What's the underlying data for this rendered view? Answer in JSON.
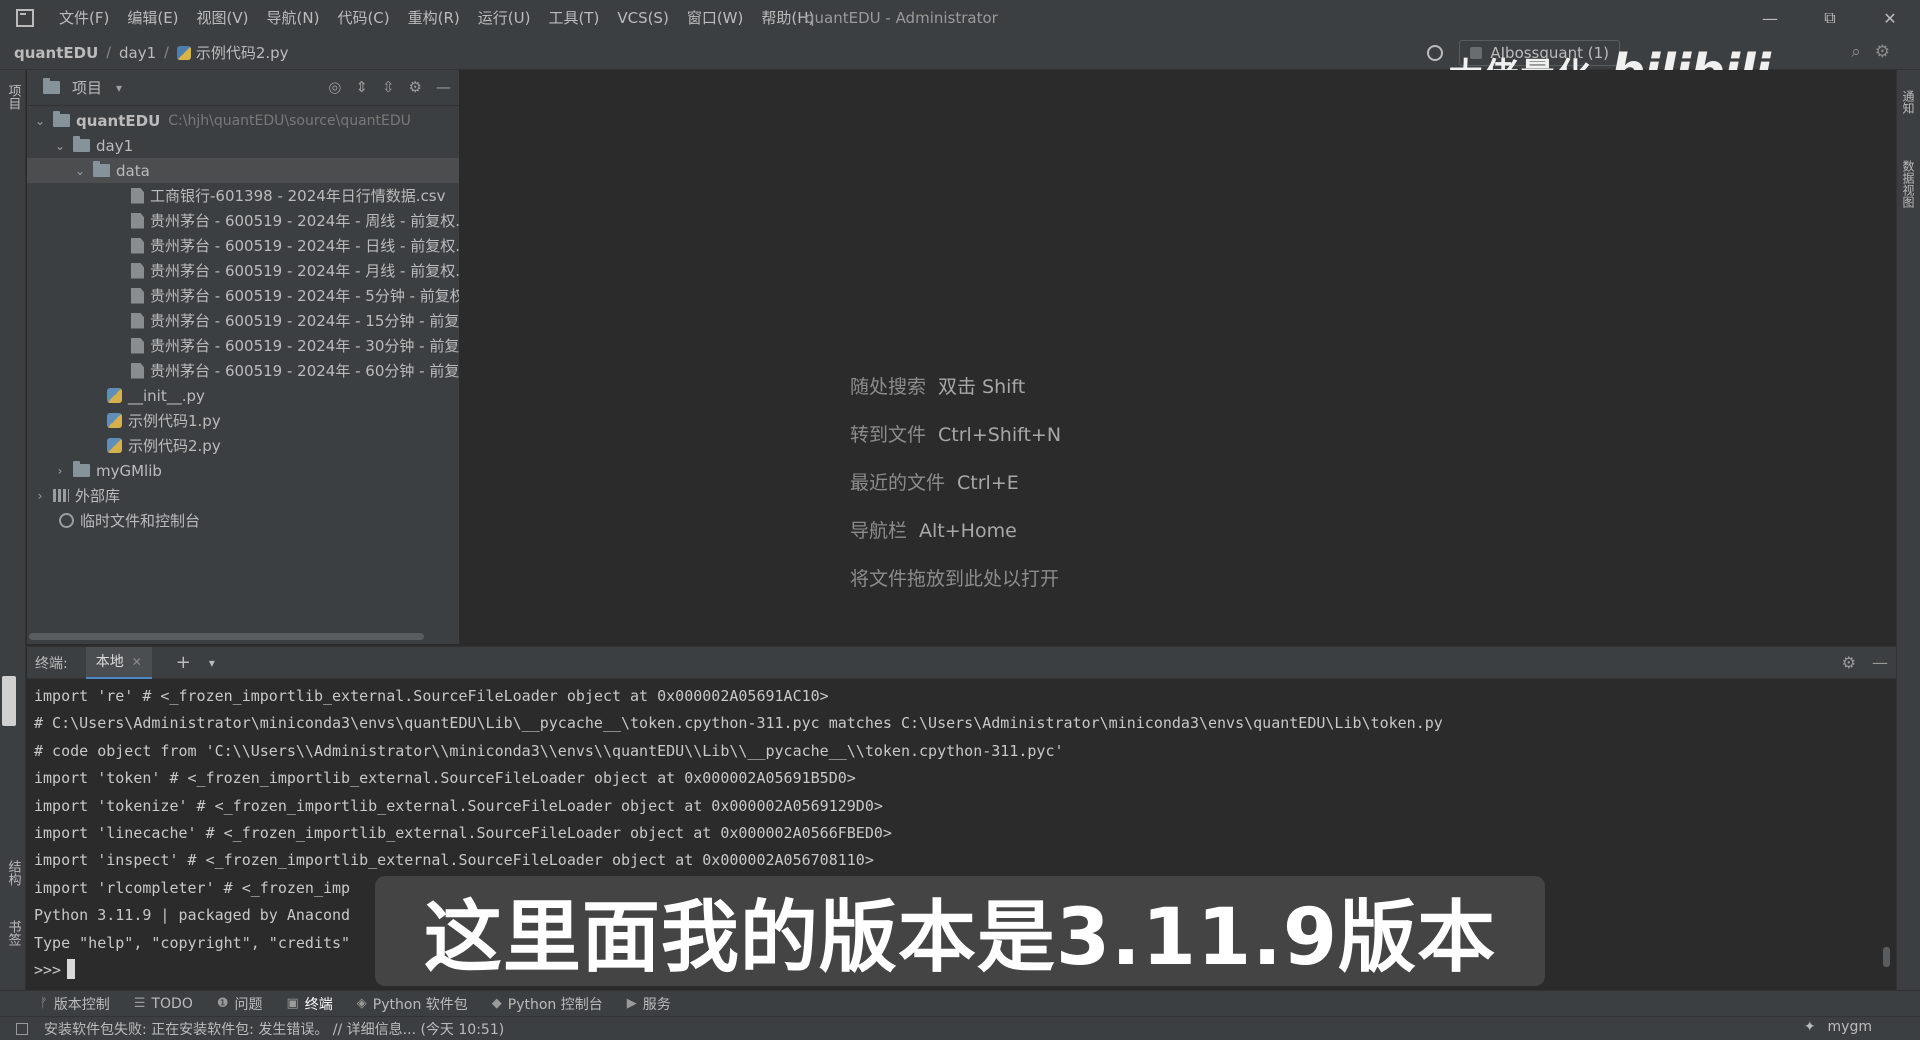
{
  "window": {
    "title": "quantEDU - Administrator",
    "menu": [
      "文件(F)",
      "编辑(E)",
      "视图(V)",
      "导航(N)",
      "代码(C)",
      "重构(R)",
      "运行(U)",
      "工具(T)",
      "VCS(S)",
      "窗口(W)",
      "帮助(H)"
    ],
    "minimize": "—",
    "restore": "⧉",
    "close": "✕"
  },
  "navbar": {
    "crumbs": [
      "quantEDU",
      "day1",
      "示例代码2.py"
    ],
    "run_config": "AIbossquant (1)"
  },
  "watermark": {
    "text": "大佬量化",
    "logo": "bilibili"
  },
  "left_strip": {
    "project_tab": "项目",
    "structure_tab": "结构",
    "bookmarks_tab": "书签"
  },
  "right_strip": {
    "notifications_tab": "通知",
    "sciview_tab": "数据视图"
  },
  "project": {
    "title": "项目",
    "tree": {
      "root": {
        "name": "quantEDU",
        "path": "C:\\hjh\\quantEDU\\source\\quantEDU"
      },
      "day1": "day1",
      "data": "data",
      "files": [
        "工商银行-601398 - 2024年日行情数据.csv",
        "贵州茅台 - 600519 - 2024年 - 周线 - 前复权.c",
        "贵州茅台 - 600519 - 2024年 - 日线 - 前复权.c",
        "贵州茅台 - 600519 - 2024年 - 月线 - 前复权.c",
        "贵州茅台 - 600519 - 2024年 - 5分钟 - 前复权",
        "贵州茅台 - 600519 - 2024年 - 15分钟 - 前复权",
        "贵州茅台 - 600519 - 2024年 - 30分钟 - 前复权",
        "贵州茅台 - 600519 - 2024年 - 60分钟 - 前复权"
      ],
      "py_files": [
        "__init__.py",
        "示例代码1.py",
        "示例代码2.py"
      ],
      "mygmlib": "myGMlib",
      "external": "外部库",
      "scratches": "临时文件和控制台"
    }
  },
  "editor_hints": [
    {
      "label": "随处搜索",
      "key": "双击 Shift"
    },
    {
      "label": "转到文件",
      "key": "Ctrl+Shift+N"
    },
    {
      "label": "最近的文件",
      "key": "Ctrl+E"
    },
    {
      "label": "导航栏",
      "key": "Alt+Home"
    },
    {
      "label": "将文件拖放到此处以打开",
      "key": ""
    }
  ],
  "terminal": {
    "label": "终端:",
    "tab": "本地",
    "lines": [
      "import 're' # <_frozen_importlib_external.SourceFileLoader object at 0x000002A05691AC10>",
      "# C:\\Users\\Administrator\\miniconda3\\envs\\quantEDU\\Lib\\__pycache__\\token.cpython-311.pyc matches C:\\Users\\Administrator\\miniconda3\\envs\\quantEDU\\Lib\\token.py",
      "# code object from 'C:\\\\Users\\\\Administrator\\\\miniconda3\\\\envs\\\\quantEDU\\\\Lib\\\\__pycache__\\\\token.cpython-311.pyc'",
      "import 'token' # <_frozen_importlib_external.SourceFileLoader object at 0x000002A05691B5D0>",
      "import 'tokenize' # <_frozen_importlib_external.SourceFileLoader object at 0x000002A0569129D0>",
      "import 'linecache' # <_frozen_importlib_external.SourceFileLoader object at 0x000002A0566FBED0>",
      "import 'inspect' # <_frozen_importlib_external.SourceFileLoader object at 0x000002A056708110>",
      "import 'rlcompleter' # <_frozen_imp",
      "Python 3.11.9 | packaged by Anacond",
      "Type \"help\", \"copyright\", \"credits\""
    ],
    "prompt": ">>>"
  },
  "subtitle": "这里面我的版本是3.11.9版本",
  "tool_windows": [
    "版本控制",
    "TODO",
    "问题",
    "终端",
    "Python 软件包",
    "Python 控制台",
    "服务"
  ],
  "status": {
    "message": "安装软件包失败: 正在安装软件包: 发生错误。 // 详细信息... (今天 10:51)",
    "user": "mygm"
  }
}
